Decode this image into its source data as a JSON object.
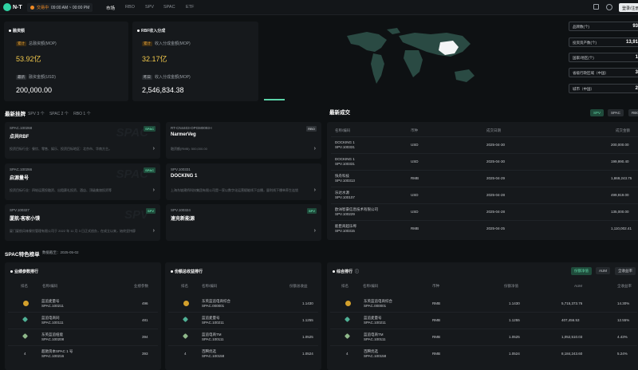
{
  "nav": {
    "logo": "N-T",
    "market_status": "交易中",
    "market_hours": "09:00 AM ~ 00:00 PM",
    "links": [
      "市场",
      "RBO",
      "SPV",
      "SPAC",
      "ETF"
    ],
    "login": "登录/注册"
  },
  "financing": {
    "title": "融资额",
    "cum_tag": "累计",
    "cum_label": "总融资额(MOP)",
    "cum_value": "53.92亿",
    "new_tag": "最新",
    "new_label": "融资金额(USD)",
    "new_value": "200,000.00"
  },
  "rbf": {
    "title": "RBF收入分成",
    "cum_tag": "累计",
    "cum_label": "收入分成金额(MOP)",
    "cum_value": "32.17亿",
    "new_tag": "昨日",
    "new_label": "收入分成金额(MOP)",
    "new_value": "2,546,834.38"
  },
  "stats": [
    {
      "label": "品牌数(个)",
      "value": "93"
    },
    {
      "label": "投资资产数(个)",
      "value": "13,91"
    },
    {
      "label": "国家/地区(个)",
      "value": "1"
    },
    {
      "label": "省级行政区域（中国）",
      "value": "3"
    },
    {
      "label": "城市（中国）",
      "value": "2"
    }
  ],
  "listings": {
    "title": "最新挂牌",
    "tabs": [
      "SPV 3 个",
      "SPAC 2 个",
      "RBO 1 个"
    ],
    "items": [
      {
        "code": "SPAC.100268",
        "name": "点共RBF",
        "desc": "投资目标行业：餐饮、零售、娱乐、投资目标地区：北京市、华南方主。",
        "badge": "SPAC",
        "type": "spac"
      },
      {
        "code": "RT-CN4403-OPGM0093-I",
        "name": "NarmerVeg",
        "desc": "融资额(RMB): 500,000.00",
        "badge": "RBO",
        "type": "rbo"
      },
      {
        "code": "SPAC.100266",
        "name": "启源量号",
        "desc": "投资目标行业：四轮运营投融资、出租赛礼投资、酒店、顶级美旅投资等",
        "badge": "SPAC",
        "type": "spac"
      },
      {
        "code": "SPV.100331",
        "name": "DOCKING 1",
        "desc": "上海东坡建桥科技集团有限公司是一家以数字化运营赋能线下店播，量利线下爆单养生连锁",
        "badge": "SPV",
        "type": "spv"
      },
      {
        "code": "SPV.100327",
        "name": "厦航-客家小馍",
        "desc": "厦门厦航风味餐饮管理有限公司于 2022 年 11 月 3 日正式创办，在成立以来，始终坚持醇",
        "badge": "SPV",
        "type": "spv"
      },
      {
        "code": "SPV.100324",
        "name": "速充新能源",
        "desc": "",
        "badge": "SPV",
        "type": "spv"
      }
    ]
  },
  "deals": {
    "title": "最新成交",
    "buttons": [
      "SPV",
      "SPAC",
      "RBO"
    ],
    "headers": [
      "名称/编码",
      "币种",
      "成交日期",
      "成交金额"
    ],
    "rows": [
      {
        "name": "DOCKING 1",
        "code": "SPV.100331",
        "currency": "USD",
        "date": "2025-04-30",
        "amount": "200,000.00"
      },
      {
        "name": "DOCKING 1",
        "code": "SPV.100331",
        "currency": "USD",
        "date": "2025-04-30",
        "amount": "199,990.40"
      },
      {
        "name": "快舟科技",
        "code": "SPV.100313",
        "currency": "RMB",
        "date": "2025-04-29",
        "amount": "1,869,243.75"
      },
      {
        "name": "乐达水源",
        "code": "SPV.100107",
        "currency": "USD",
        "date": "2025-04-28",
        "amount": "499,919.00"
      },
      {
        "name": "欧洲智豪信息技术有限公司",
        "code": "SPV.100229",
        "currency": "USD",
        "date": "2025-04-28",
        "amount": "135,000.00"
      },
      {
        "name": "能臣商超乐埠",
        "code": "SPV.100315",
        "currency": "RMB",
        "date": "2025-04-25",
        "amount": "1,110,002.41"
      }
    ]
  },
  "spac": {
    "title": "SPAC特色榜单",
    "date_label": "数据截至：2025-05-02",
    "boards": [
      {
        "title": "业绩参数排行",
        "headers": [
          "排名",
          "名称/编码",
          "业绩参数"
        ],
        "rows": [
          {
            "rank": "1",
            "name": "蓝追麦量号",
            "code": "SPAC.100211",
            "value": "496"
          },
          {
            "rank": "2",
            "name": "蓝追电商同",
            "code": "SPAC.100111",
            "value": "481"
          },
          {
            "rank": "3",
            "name": "东英蓝追纽能",
            "code": "SPAC.100208",
            "value": "394"
          },
          {
            "rank": "4",
            "name": "超驰资本SPAC 1 号",
            "code": "SPAC.100216",
            "value": "393"
          }
        ]
      },
      {
        "title": "份额总收益排行",
        "headers": [
          "排名",
          "名称/编码",
          "份额总收益"
        ],
        "rows": [
          {
            "rank": "1",
            "name": "东英蓝追电商综合",
            "code": "SPAC.000001",
            "value": "1.1430"
          },
          {
            "rank": "2",
            "name": "蓝追麦量号",
            "code": "SPAC.100211",
            "value": "1.1255"
          },
          {
            "rank": "3",
            "name": "蓝追电商TM",
            "code": "SPAC.100111",
            "value": "1.0525"
          },
          {
            "rank": "4",
            "name": "百腾优选",
            "code": "SPAC.100158",
            "value": "1.0524"
          }
        ]
      },
      {
        "title": "综合排行",
        "buttons": [
          "份额净值",
          "AUM",
          "全收益率"
        ],
        "headers": [
          "排名",
          "名称/编码",
          "币种",
          "份额净值",
          "AUM",
          "全收益率"
        ],
        "rows": [
          {
            "rank": "1",
            "name": "东英蓝追电商综合",
            "code": "SPAC.000001",
            "currency": "RMB",
            "nav": "1.1430",
            "aum": "5,715,373.76",
            "ret": "14.30%"
          },
          {
            "rank": "2",
            "name": "蓝追麦量号",
            "code": "SPAC.100211",
            "currency": "RMB",
            "nav": "1.1255",
            "aum": "407,456.53",
            "ret": "12.55%"
          },
          {
            "rank": "3",
            "name": "蓝追电商TM",
            "code": "SPAC.100111",
            "currency": "RMB",
            "nav": "1.0525",
            "aum": "1,052,510.03",
            "ret": "4.43%"
          },
          {
            "rank": "4",
            "name": "百腾优选",
            "code": "SPAC.100158",
            "currency": "RMB",
            "nav": "1.0524",
            "aum": "8,184,243.60",
            "ret": "5.24%"
          }
        ]
      }
    ]
  },
  "colors": {
    "accent": "#5bd3a8",
    "gold": "#f2c94c",
    "bg": "#0e1113",
    "panel": "#16191c"
  }
}
